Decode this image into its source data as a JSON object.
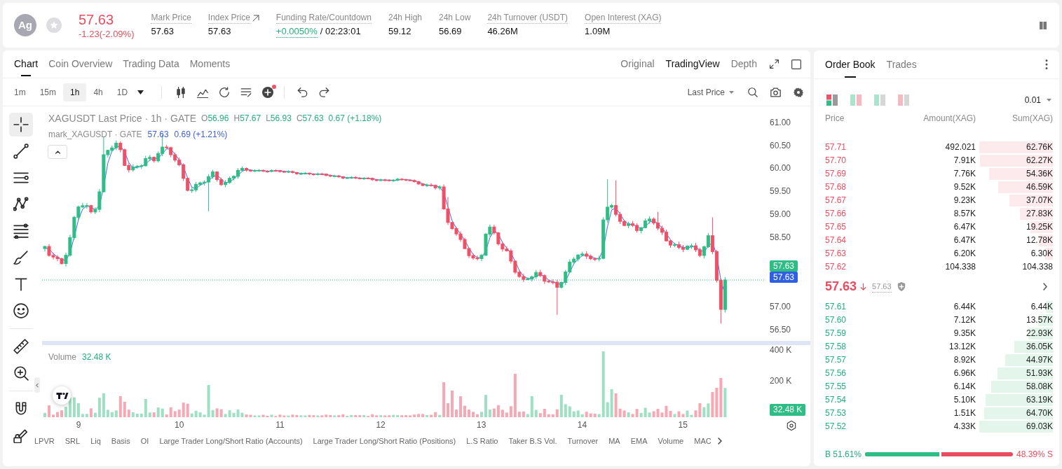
{
  "header": {
    "symbol_icon": "Ag",
    "favorite": false,
    "falling": true,
    "last_price": "57.63",
    "change": "-1.23(-2.09%)",
    "stats": [
      {
        "kind": "plain",
        "label": "Mark Price",
        "value": "57.63",
        "underlined": true
      },
      {
        "kind": "link",
        "label": "Index Price",
        "value": "57.63",
        "underlined": true
      },
      {
        "kind": "funding",
        "label": "Funding Rate/Countdown",
        "value": "+0.0050%",
        "countdown": "/ 02:23:01",
        "underlined": true
      },
      {
        "kind": "plain",
        "label": "24h High",
        "value": "59.12",
        "underlined": false
      },
      {
        "kind": "plain",
        "label": "24h Low",
        "value": "56.69",
        "underlined": false
      },
      {
        "kind": "plain",
        "label": "24h Turnover (USDT)",
        "value": "46.26M",
        "underlined": true
      },
      {
        "kind": "plain",
        "label": "Open Interest (XAG)",
        "value": "1.09M",
        "underlined": true
      }
    ]
  },
  "chart_panel": {
    "tabs": [
      {
        "label": "Chart",
        "selected": true
      },
      {
        "label": "Coin Overview",
        "selected": false
      },
      {
        "label": "Trading Data",
        "selected": false
      },
      {
        "label": "Moments",
        "selected": false
      }
    ],
    "views": [
      {
        "label": "Original",
        "selected": false
      },
      {
        "label": "TradingView",
        "selected": true
      },
      {
        "label": "Depth",
        "selected": false
      }
    ],
    "intervals": [
      {
        "label": "1m",
        "selected": false
      },
      {
        "label": "15m",
        "selected": false
      },
      {
        "label": "1h",
        "selected": true
      },
      {
        "label": "4h",
        "selected": false
      },
      {
        "label": "1D",
        "selected": false
      }
    ],
    "price_source": "Last Price",
    "drawing_tool_groups": [
      {
        "tools": [
          {
            "kind": "crosshair",
            "selected": true
          },
          {
            "kind": "trend_line",
            "selected": false
          },
          {
            "kind": "horizontal_lines",
            "selected": false
          },
          {
            "kind": "pattern",
            "selected": false
          },
          {
            "kind": "fibonacci",
            "selected": false
          },
          {
            "kind": "brush",
            "selected": false
          },
          {
            "kind": "text",
            "selected": false
          },
          {
            "kind": "emoji",
            "selected": false
          }
        ]
      },
      {
        "tools": [
          {
            "kind": "ruler",
            "selected": false
          },
          {
            "kind": "zoom_in",
            "selected": false
          }
        ]
      },
      {
        "tools": [
          {
            "kind": "magnet",
            "selected": false
          },
          {
            "kind": "lock_drawing",
            "selected": false
          }
        ]
      }
    ],
    "legend": {
      "title": "XAGUSDT Last Price · 1h · GATE",
      "ohlc": [
        {
          "label": "O",
          "value": "56.96"
        },
        {
          "label": "H",
          "value": "57.67"
        },
        {
          "label": "L",
          "value": "56.93"
        },
        {
          "label": "C",
          "value": "57.63"
        }
      ],
      "change": "0.67 (+1.18%)",
      "mark_title": "mark_XAGUSDT · GATE",
      "mark_price": "57.63",
      "mark_change": "0.69 (+1.21%)"
    },
    "price_axis": [
      {
        "kind": "tick",
        "text": "61.00"
      },
      {
        "kind": "tick",
        "text": "60.50"
      },
      {
        "kind": "tick",
        "text": "60.00"
      },
      {
        "kind": "tick",
        "text": "59.50"
      },
      {
        "kind": "tick",
        "text": "59.00"
      },
      {
        "kind": "tick",
        "text": "58.50"
      },
      {
        "kind": "last_price",
        "text": "57.63"
      },
      {
        "kind": "mark_price",
        "text": "57.63"
      },
      {
        "kind": "tick",
        "text": "57.00"
      },
      {
        "kind": "tick",
        "text": "56.50"
      }
    ],
    "volume": {
      "label": "Volume",
      "value": "32.48 K",
      "axis_labels": [
        "400 K",
        "200 K"
      ],
      "tag": "32.48 K"
    },
    "time_axis": [
      "9",
      "10",
      "11",
      "12",
      "13",
      "14",
      "15"
    ],
    "indicators": [
      "LPVR",
      "SRL",
      "Liq",
      "Basis",
      "OI",
      "Large Trader Long/Short Ratio (Accounts)",
      "Large Trader Long/Short Ratio (Positions)",
      "L.S Ratio",
      "Taker B.S Vol.",
      "Turnover",
      "MA",
      "EMA",
      "Volume",
      "MAC"
    ]
  },
  "order_book": {
    "tabs": [
      {
        "label": "Order Book",
        "selected": true
      },
      {
        "label": "Trades",
        "selected": false
      }
    ],
    "layouts": [
      {
        "kind": "split",
        "selected": true
      },
      {
        "kind": "both",
        "selected": false
      },
      {
        "kind": "bids",
        "selected": false
      },
      {
        "kind": "asks",
        "selected": false
      }
    ],
    "tick_size": "0.01",
    "columns": [
      "Price",
      "Amount(XAG)",
      "Sum(XAG)"
    ],
    "asks": [
      {
        "price": "57.71",
        "amount": "492.021",
        "sum": "62.76K"
      },
      {
        "price": "57.70",
        "amount": "7.91K",
        "sum": "62.27K"
      },
      {
        "price": "57.69",
        "amount": "7.76K",
        "sum": "54.36K"
      },
      {
        "price": "57.68",
        "amount": "9.52K",
        "sum": "46.59K"
      },
      {
        "price": "57.67",
        "amount": "9.23K",
        "sum": "37.07K"
      },
      {
        "price": "57.66",
        "amount": "8.57K",
        "sum": "27.83K"
      },
      {
        "price": "57.65",
        "amount": "6.47K",
        "sum": "19.25K"
      },
      {
        "price": "57.64",
        "amount": "6.47K",
        "sum": "12.78K"
      },
      {
        "price": "57.63",
        "amount": "6.20K",
        "sum": "6.30K"
      },
      {
        "price": "57.62",
        "amount": "104.338",
        "sum": "104.338"
      }
    ],
    "last_price": {
      "price": "57.63",
      "falling": true,
      "mark": "57.63"
    },
    "bids": [
      {
        "price": "57.61",
        "amount": "6.44K",
        "sum": "6.44K"
      },
      {
        "price": "57.60",
        "amount": "7.12K",
        "sum": "13.57K"
      },
      {
        "price": "57.59",
        "amount": "9.35K",
        "sum": "22.93K"
      },
      {
        "price": "57.58",
        "amount": "13.12K",
        "sum": "36.05K"
      },
      {
        "price": "57.57",
        "amount": "8.92K",
        "sum": "44.97K"
      },
      {
        "price": "57.56",
        "amount": "6.96K",
        "sum": "51.93K"
      },
      {
        "price": "57.55",
        "amount": "6.14K",
        "sum": "58.08K"
      },
      {
        "price": "57.54",
        "amount": "5.10K",
        "sum": "63.19K"
      },
      {
        "price": "57.53",
        "amount": "1.51K",
        "sum": "64.70K"
      },
      {
        "price": "57.52",
        "amount": "4.33K",
        "sum": "69.03K"
      }
    ],
    "ratio": {
      "buy": "B 51.61%",
      "sell": "48.39% S",
      "level": 0.5161
    }
  }
}
